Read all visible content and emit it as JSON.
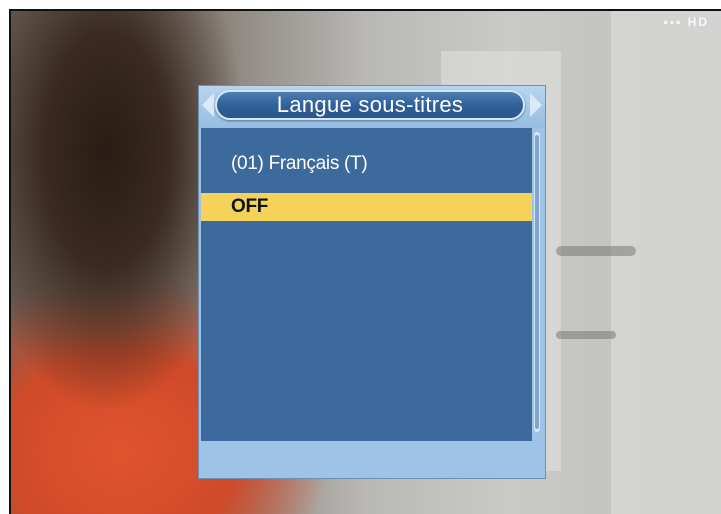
{
  "screen": {
    "corner_mark": "▪▪▪ HD"
  },
  "dialog": {
    "title": "Langue sous-titres",
    "items": [
      {
        "label": "(01) Français (T)",
        "selected": false
      },
      {
        "label": "OFF",
        "selected": true
      }
    ]
  },
  "colors": {
    "panel_blue": "#3d6a9d",
    "frame_light_blue": "#9ec3e6",
    "title_pill_blue": "#2f5f98",
    "selection_yellow": "#f4d358"
  }
}
